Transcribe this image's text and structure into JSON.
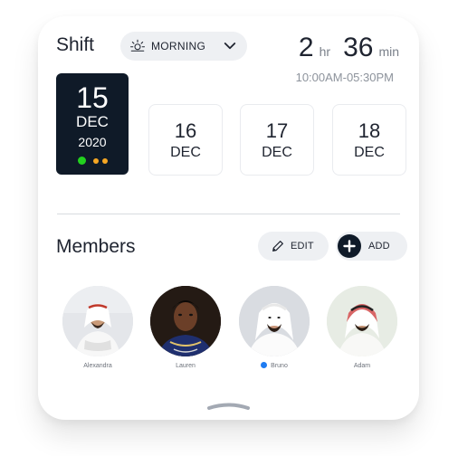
{
  "shift": {
    "title": "Shift",
    "selected": "MORNING",
    "duration_hours": "2",
    "hours_unit": "hr",
    "duration_minutes": "36",
    "minutes_unit": "min",
    "time_range": "10:00AM-05:30PM"
  },
  "dates": {
    "active": {
      "day": "15",
      "month": "DEC",
      "year": "2020"
    },
    "items": [
      {
        "day": "16",
        "month": "DEC"
      },
      {
        "day": "17",
        "month": "DEC"
      },
      {
        "day": "18",
        "month": "DEC"
      }
    ]
  },
  "members": {
    "title": "Members",
    "edit_label": "EDIT",
    "add_label": "ADD",
    "list": [
      {
        "name": "Alexandra"
      },
      {
        "name": "Lauren"
      },
      {
        "name": "Bruno"
      },
      {
        "name": "Adam"
      }
    ]
  },
  "colors": {
    "accent_dark": "#0f1a28",
    "status_green": "#22d11e",
    "status_orange": "#f5a623",
    "online_blue": "#1e7cf2"
  }
}
